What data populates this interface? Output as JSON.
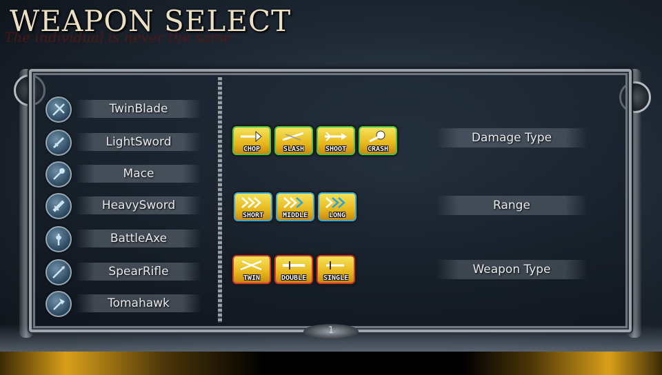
{
  "header": {
    "title": "WEAPON SELECT",
    "subtitle": "The individual is never the same"
  },
  "weapons": [
    {
      "label": "TwinBlade",
      "icon": "twinblade-icon"
    },
    {
      "label": "LightSword",
      "icon": "lightsword-icon"
    },
    {
      "label": "Mace",
      "icon": "mace-icon"
    },
    {
      "label": "HeavySword",
      "icon": "heavysword-icon"
    },
    {
      "label": "BattleAxe",
      "icon": "battleaxe-icon"
    },
    {
      "label": "SpearRifle",
      "icon": "spearrifle-icon"
    },
    {
      "label": "Tomahawk",
      "icon": "tomahawk-icon"
    }
  ],
  "damage_types": [
    "CHOP",
    "SLASH",
    "SHOOT",
    "CRASH"
  ],
  "ranges": [
    "SHORT",
    "MIDDLE",
    "LONG"
  ],
  "weapon_types": [
    "TWIN",
    "DOUBLE",
    "SINGLE"
  ],
  "categories": {
    "damage": "Damage Type",
    "range": "Range",
    "weapon_type": "Weapon Type"
  },
  "page": {
    "number": "1"
  },
  "colors": {
    "damage_border": "#49c24a",
    "range_border": "#38a9d9",
    "weapon_type_border": "#d0362e",
    "badge_fill": "#e8b81e"
  }
}
